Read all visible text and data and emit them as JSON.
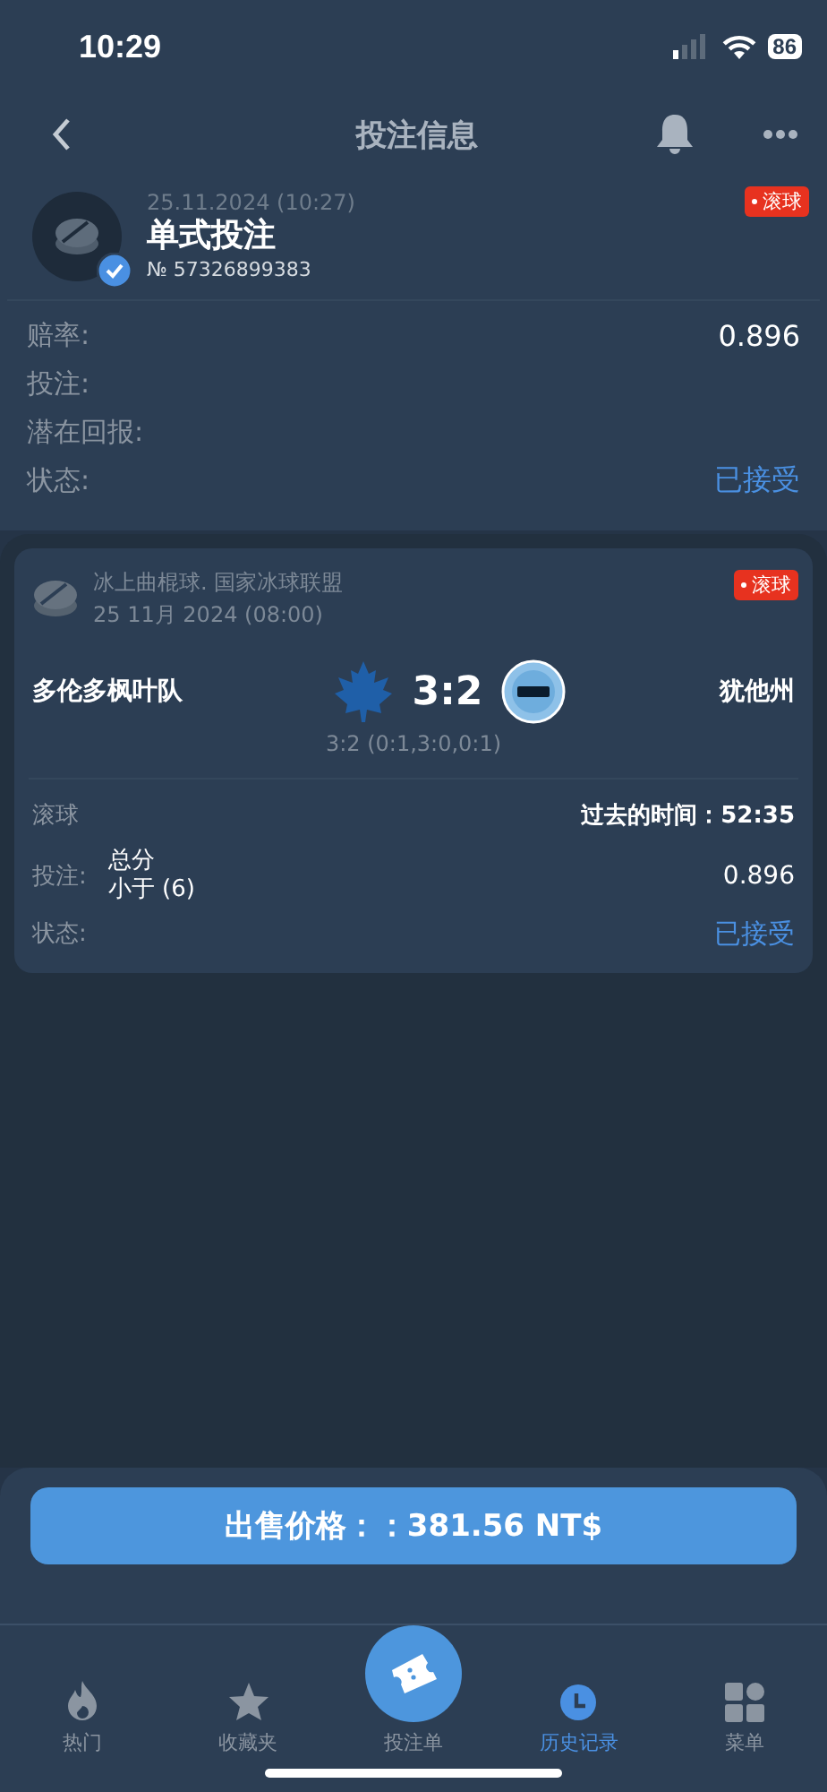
{
  "status_bar": {
    "time": "10:29",
    "battery": "86"
  },
  "header": {
    "title": "投注信息"
  },
  "bet": {
    "live_badge": "滚球",
    "date": "25.11.2024 (10:27)",
    "type": "单式投注",
    "number": "№ 57326899383",
    "verified": true
  },
  "summary": [
    {
      "label": "赔率:",
      "value": "0.896",
      "kind": "odds"
    },
    {
      "label": "投注:",
      "kind": "empty"
    },
    {
      "label": "潜在回报:",
      "kind": "empty"
    },
    {
      "label": "状态:",
      "value": "已接受",
      "kind": "status"
    }
  ],
  "event": {
    "sport_league": "冰上曲棍球. 国家冰球联盟",
    "date": "25 11月 2024 (08:00)",
    "live_badge": "滚球",
    "home": "多伦多枫叶队",
    "away": "犹他州",
    "score": "3:2",
    "periods": "3:2 (0:1,3:0,0:1)",
    "mode": "滚球",
    "elapsed": "过去的时间：52:35",
    "bet_label": "投注:",
    "market": "总分",
    "pick": "小于 (6)",
    "odds": "0.896",
    "status_label": "状态:",
    "status": "已接受"
  },
  "sell_button": "出售价格：：381.56 NT$",
  "tabs": [
    {
      "label": "热门",
      "kind": "hot",
      "selected": false
    },
    {
      "label": "收藏夹",
      "kind": "favorites",
      "selected": false
    },
    {
      "label": "投注单",
      "kind": "betslip",
      "selected": false
    },
    {
      "label": "历史记录",
      "kind": "history",
      "selected": true
    },
    {
      "label": "菜单",
      "kind": "menu",
      "selected": false
    }
  ]
}
